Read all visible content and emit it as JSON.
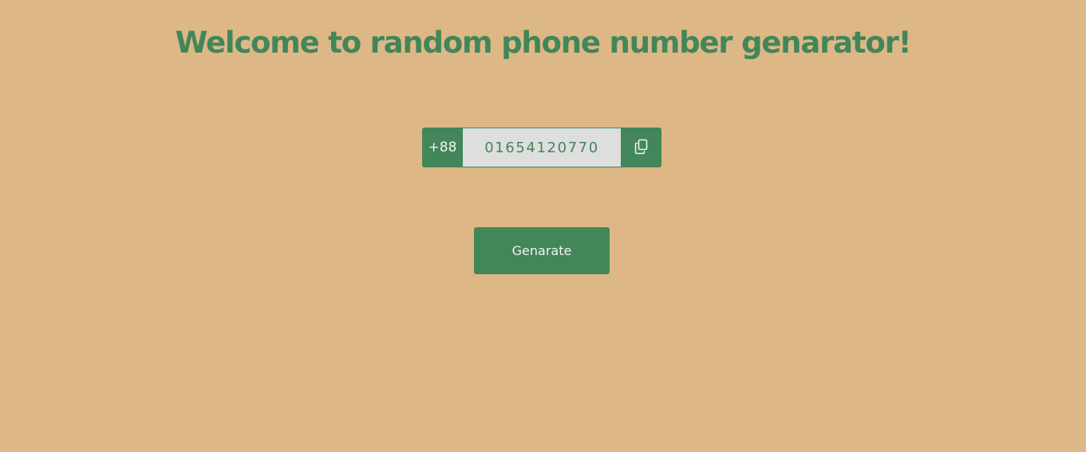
{
  "header": {
    "title": "Welcome to random phone number genarator!"
  },
  "phone": {
    "prefix": "+88",
    "number": "01654120770",
    "copy_icon": "copy-icon"
  },
  "actions": {
    "generate_label": "Genarate"
  },
  "colors": {
    "background": "#ddb786",
    "accent": "#428659",
    "field_background": "#dedede",
    "button_text": "#f2f2f2"
  }
}
